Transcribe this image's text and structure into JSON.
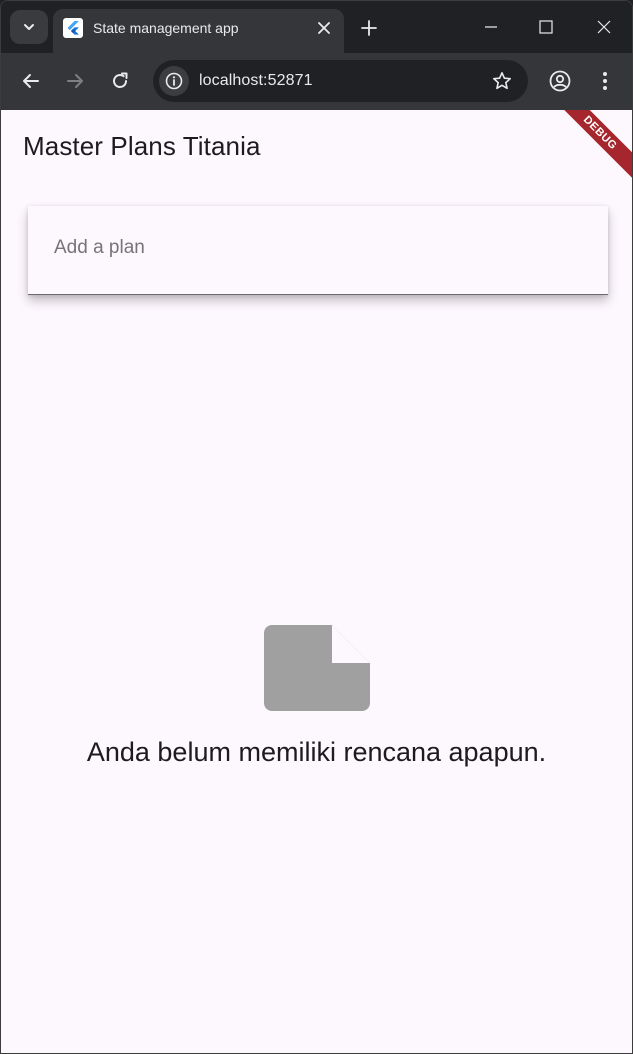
{
  "browser": {
    "tab": {
      "title": "State management app",
      "favicon": "flutter-icon"
    },
    "omnibox": {
      "url": "localhost:52871"
    },
    "icons": {
      "tab_search": "chevron-down-icon",
      "close_tab": "close-icon",
      "new_tab": "plus-icon",
      "minimize": "minimize-icon",
      "maximize": "maximize-icon",
      "close_window": "close-icon",
      "back": "arrow-left-icon",
      "forward": "arrow-right-icon",
      "reload": "reload-icon",
      "site_info": "info-icon",
      "bookmark": "star-icon",
      "profile": "account-icon",
      "menu": "more-vert-icon"
    }
  },
  "app": {
    "title": "Master Plans Titania",
    "debug_banner": "DEBUG",
    "add_plan": {
      "placeholder": "Add a plan",
      "value": ""
    },
    "empty_state": {
      "icon": "note-icon",
      "message": "Anda belum memiliki rencana apapun."
    },
    "colors": {
      "background": "#fdf7fe",
      "banner": "#a6262d",
      "icon": "#a0a0a0",
      "text": "#1d1b20"
    }
  }
}
